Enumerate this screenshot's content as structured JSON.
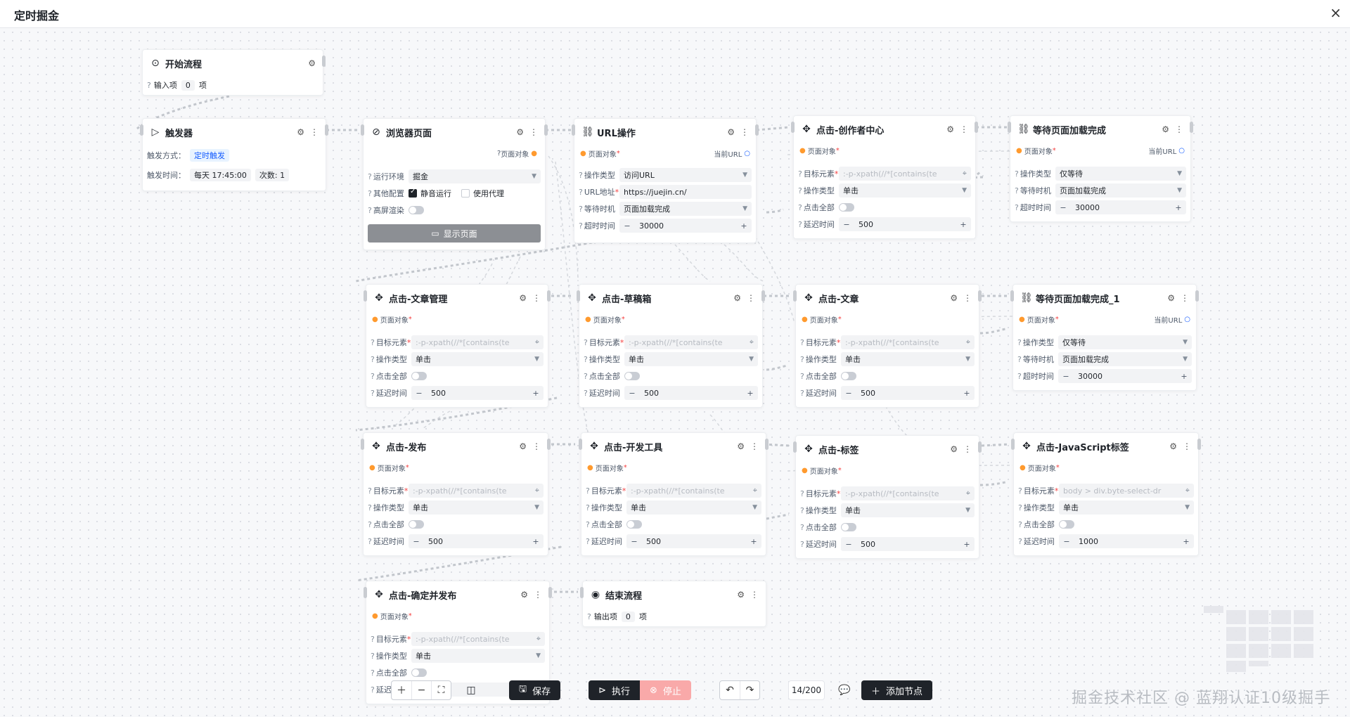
{
  "window": {
    "title": "定时掘金",
    "close_icon": "×"
  },
  "labels": {
    "page_object": "页面对象",
    "target_element": "目标元素",
    "op_type": "操作类型",
    "click_all": "点击全部",
    "delay_time": "延迟时间",
    "wait_timing": "等待时机",
    "timeout": "超时时间",
    "current_url": "当前URL",
    "url_addr": "URL地址",
    "env": "运行环境",
    "other_config": "其他配置",
    "hires": "高屏渲染",
    "unit": "项"
  },
  "start_node": {
    "title": "开始流程",
    "input_label": "输入项",
    "input_count": "0"
  },
  "end_node": {
    "title": "结束流程",
    "output_label": "输出项",
    "output_count": "0"
  },
  "trigger_node": {
    "title": "触发器",
    "method_label": "触发方式：",
    "method_value": "定时触发",
    "time_label": "触发时间：",
    "time_value": "每天 17:45:00",
    "count_value": "次数: 1"
  },
  "browser_node": {
    "title": "浏览器页面",
    "env_value": "掘金",
    "silent_label": "静音运行",
    "proxy_label": "使用代理",
    "show_button": "显示页面"
  },
  "url_node": {
    "title": "URL操作",
    "op_value": "访问URL",
    "url_value": "https://juejin.cn/",
    "wait_value": "页面加载完成",
    "timeout_value": "30000"
  },
  "wait_nodes": [
    {
      "title": "等待页面加载完成",
      "op_value": "仅等待",
      "wait_value": "页面加载完成",
      "timeout_value": "30000"
    },
    {
      "title": "等待页面加载完成_1",
      "op_value": "仅等待",
      "wait_value": "页面加载完成",
      "timeout_value": "30000"
    }
  ],
  "click_nodes": [
    {
      "title": "点击-创作者中心",
      "target": ":-p-xpath(//*[contains(te",
      "op": "单击",
      "delay": "500"
    },
    {
      "title": "点击-文章管理",
      "target": ":-p-xpath(//*[contains(te",
      "op": "单击",
      "delay": "500"
    },
    {
      "title": "点击-草稿箱",
      "target": ":-p-xpath(//*[contains(te",
      "op": "单击",
      "delay": "500"
    },
    {
      "title": "点击-文章",
      "target": ":-p-xpath(//*[contains(te",
      "op": "单击",
      "delay": "500"
    },
    {
      "title": "点击-发布",
      "target": ":-p-xpath(//*[contains(te",
      "op": "单击",
      "delay": "500"
    },
    {
      "title": "点击-开发工具",
      "target": ":-p-xpath(//*[contains(te",
      "op": "单击",
      "delay": "500"
    },
    {
      "title": "点击-标签",
      "target": ":-p-xpath(//*[contains(te",
      "op": "单击",
      "delay": "500"
    },
    {
      "title": "点击-JavaScript标签",
      "target": "body > div.byte-select-dr",
      "op": "单击",
      "delay": "1000"
    },
    {
      "title": "点击-确定并发布",
      "target": ":-p-xpath(//*[contains(te",
      "op": "单击",
      "delay": ""
    }
  ],
  "toolbar": {
    "save": "保存",
    "run": "执行",
    "stop": "停止",
    "count": "14/200",
    "add_node": "添加节点"
  },
  "watermark": "掘金技术社区 @ 蓝翔认证10级掘手"
}
